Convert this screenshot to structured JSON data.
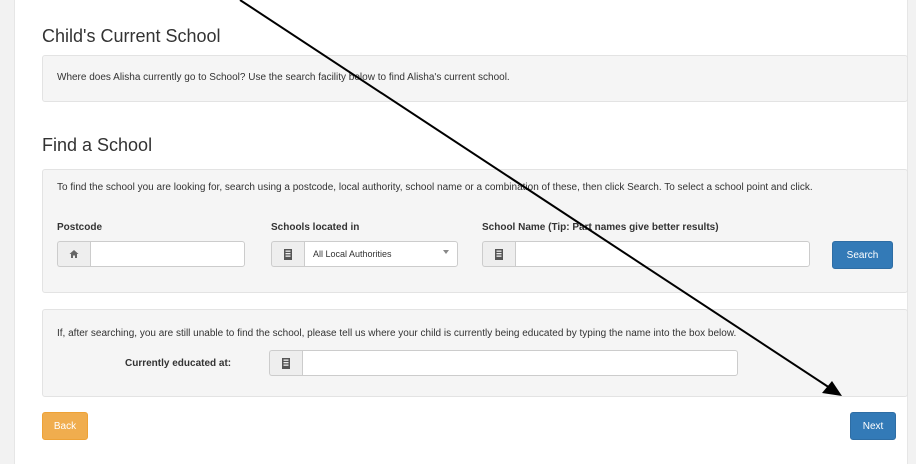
{
  "current_school": {
    "title": "Child's Current School",
    "description": "Where does Alisha currently go to School? Use the search facility below to find Alisha's current school."
  },
  "find_school": {
    "title": "Find a School",
    "instructions": "To find the school you are looking for, search using a postcode, local authority, school name or a combination of these, then click Search. To select a school point and click.",
    "postcode_label": "Postcode",
    "postcode_value": "",
    "postcode_icon": "home-icon",
    "located_label": "Schools located in",
    "located_value": "All Local Authorities",
    "located_icon": "building-icon",
    "school_name_label": "School Name (Tip: Part names give better results)",
    "school_name_value": "",
    "school_name_icon": "building-icon",
    "search_label": "Search"
  },
  "unable": {
    "text": "If, after searching, you are still unable to find the school, please tell us where your child is currently being educated by typing the name into the box below.",
    "currently_label": "Currently educated at:",
    "currently_value": "",
    "currently_icon": "building-icon"
  },
  "nav": {
    "back_label": "Back",
    "next_label": "Next"
  },
  "colors": {
    "primary": "#337ab7",
    "warning": "#f0ad4e",
    "well": "#f5f5f5",
    "arrow": "#000000"
  }
}
